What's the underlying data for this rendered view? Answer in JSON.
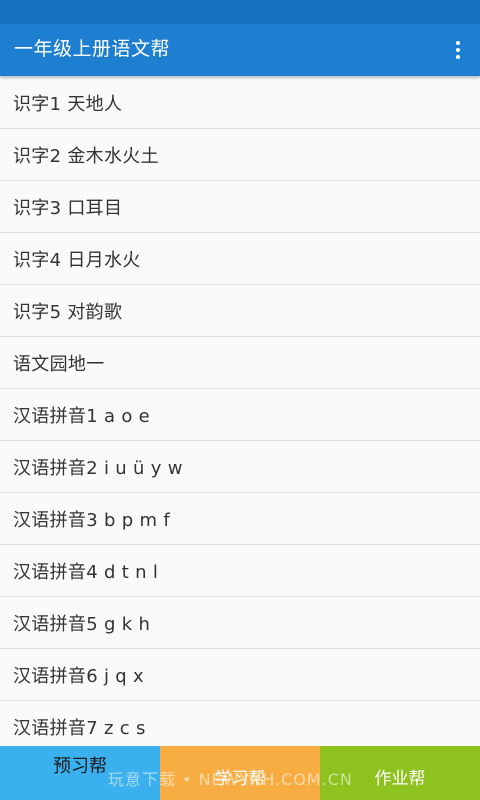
{
  "app": {
    "title": "一年级上册语文帮"
  },
  "toolbar": {
    "menu_icon": "more-vertical-icon"
  },
  "lessons": [
    {
      "label": "识字1 天地人"
    },
    {
      "label": "识字2 金木水火土"
    },
    {
      "label": "识字3 口耳目"
    },
    {
      "label": "识字4 日月水火"
    },
    {
      "label": "识字5 对韵歌"
    },
    {
      "label": "语文园地一"
    },
    {
      "label": "汉语拼音1 a o e"
    },
    {
      "label": "汉语拼音2 i u ü y w"
    },
    {
      "label": "汉语拼音3 b p m f"
    },
    {
      "label": "汉语拼音4 d t n l"
    },
    {
      "label": "汉语拼音5 g k h"
    },
    {
      "label": "汉语拼音6 j q x"
    },
    {
      "label": "汉语拼音7 z c s"
    }
  ],
  "bottom_nav": {
    "tabs": [
      {
        "label": "预习帮",
        "color": "#3ab0ee"
      },
      {
        "label": "学习帮",
        "color": "#f7ad42"
      },
      {
        "label": "作业帮",
        "color": "#8dc21f"
      }
    ]
  },
  "watermark": "玩意下载 • NEWYXH.COM.CN",
  "colors": {
    "toolbar": "#1e7fd0",
    "status_bar": "#1572c3",
    "list_background": "#fafafa",
    "divider": "#e2e2e2"
  }
}
